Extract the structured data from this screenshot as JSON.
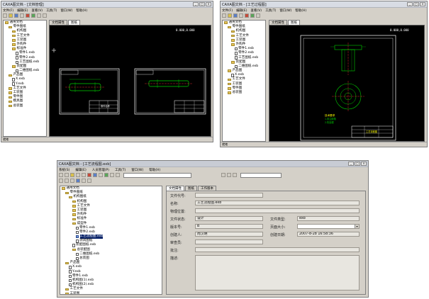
{
  "win_left": {
    "title": "CAXA图文档 - [文档管理]",
    "menu": [
      "文件(F)",
      "编辑(E)",
      "查看(V)",
      "工具(T)",
      "窗口(W)",
      "帮助(H)"
    ],
    "tabs": [
      "文档属性",
      "图纸"
    ],
    "tree": [
      {
        "text": "通用文档",
        "icon": "folder",
        "indent": 0
      },
      {
        "text": "零件图纸",
        "icon": "folder",
        "indent": 1
      },
      {
        "text": "机构图",
        "icon": "folder",
        "indent": 2
      },
      {
        "text": "工艺文件",
        "icon": "folder",
        "indent": 2
      },
      {
        "text": "工装图",
        "icon": "folder",
        "indent": 2
      },
      {
        "text": "外购件",
        "icon": "folder",
        "indent": 2
      },
      {
        "text": "标准件",
        "icon": "folder",
        "indent": 2
      },
      {
        "text": "零件1.exb",
        "icon": "doc",
        "indent": 3
      },
      {
        "text": "零件2.exb",
        "icon": "doc",
        "indent": 3
      },
      {
        "text": "工艺图纸.exb",
        "icon": "doc",
        "indent": 3
      },
      {
        "text": "装配图",
        "icon": "folder",
        "indent": 2
      },
      {
        "text": "二维图纸.exb",
        "icon": "doc",
        "indent": 3
      },
      {
        "text": "产品图",
        "icon": "folder",
        "indent": 1
      },
      {
        "text": "X.exb",
        "icon": "doc",
        "indent": 2
      },
      {
        "text": "Y.exb",
        "icon": "doc",
        "indent": 2
      },
      {
        "text": "工艺文件",
        "icon": "folder",
        "indent": 1
      },
      {
        "text": "工装图",
        "icon": "folder",
        "indent": 1
      },
      {
        "text": "零件图",
        "icon": "folder",
        "indent": 1
      },
      {
        "text": "模具图",
        "icon": "folder",
        "indent": 1
      },
      {
        "text": "总装图",
        "icon": "folder",
        "indent": 1
      }
    ],
    "status": "就绪"
  },
  "win_right": {
    "title": "CAXA图文档 - [工艺过程图]",
    "menu": [
      "文件(F)",
      "编辑(E)",
      "查看(V)",
      "工具(T)",
      "窗口(W)",
      "帮助(H)"
    ],
    "tabs": [
      "文档属性",
      "图纸"
    ],
    "tree": [
      {
        "text": "通用文档",
        "icon": "folder",
        "indent": 0
      },
      {
        "text": "零件图纸",
        "icon": "folder",
        "indent": 1
      },
      {
        "text": "机构图",
        "icon": "folder",
        "indent": 2
      },
      {
        "text": "工艺文件",
        "icon": "folder",
        "indent": 2
      },
      {
        "text": "工装图",
        "icon": "folder",
        "indent": 2
      },
      {
        "text": "外购件",
        "icon": "folder",
        "indent": 2
      },
      {
        "text": "零件1.exb",
        "icon": "doc",
        "indent": 3
      },
      {
        "text": "零件2.exb",
        "icon": "doc",
        "indent": 3
      },
      {
        "text": "工艺图纸.exb",
        "icon": "doc",
        "indent": 3
      },
      {
        "text": "装配图",
        "icon": "folder",
        "indent": 2
      },
      {
        "text": "二维图纸.exb",
        "icon": "doc",
        "indent": 3
      },
      {
        "text": "产品图",
        "icon": "folder",
        "indent": 1
      },
      {
        "text": "X.exb",
        "icon": "doc",
        "indent": 2
      },
      {
        "text": "工艺文件",
        "icon": "folder",
        "indent": 1
      },
      {
        "text": "工装图",
        "icon": "folder",
        "indent": 1
      },
      {
        "text": "零件图",
        "icon": "folder",
        "indent": 1
      },
      {
        "text": "总装图",
        "icon": "folder",
        "indent": 1
      }
    ],
    "status": "就绪"
  },
  "win_bottom": {
    "title": "CAXA图文档 - [工艺流程图.exb]",
    "menu": [
      "系统(S)",
      "编辑(E)",
      "人员管理(P)",
      "工具(T)",
      "窗口(W)",
      "帮助(H)"
    ],
    "tabs": [
      "文档属性",
      "图纸",
      "工作版本"
    ],
    "tree": [
      {
        "text": "通用文档",
        "icon": "folder",
        "indent": 0
      },
      {
        "text": "零件图纸",
        "icon": "folder",
        "indent": 1
      },
      {
        "text": "机构图纸",
        "icon": "folder",
        "indent": 2
      },
      {
        "text": "机构图",
        "icon": "folder",
        "indent": 3
      },
      {
        "text": "工艺文件",
        "icon": "folder",
        "indent": 3
      },
      {
        "text": "工装图",
        "icon": "folder",
        "indent": 3
      },
      {
        "text": "外购件",
        "icon": "folder",
        "indent": 3
      },
      {
        "text": "标准件",
        "icon": "folder",
        "indent": 3
      },
      {
        "text": "成型件",
        "icon": "folder",
        "indent": 3
      },
      {
        "text": "零件1.exb",
        "icon": "doc",
        "indent": 4
      },
      {
        "text": "零件2.exb",
        "icon": "doc",
        "indent": 4
      },
      {
        "text": "工艺流程图.exb",
        "icon": "dwg",
        "indent": 4,
        "selected": true
      },
      {
        "text": "测试图纸",
        "icon": "doc",
        "indent": 4
      },
      {
        "text": "装配图纸.exb",
        "icon": "doc",
        "indent": 3
      },
      {
        "text": "总装配图",
        "icon": "folder",
        "indent": 3
      },
      {
        "text": "二维图纸.exb",
        "icon": "doc",
        "indent": 4
      },
      {
        "text": "总装图",
        "icon": "doc",
        "indent": 4
      },
      {
        "text": "产品图",
        "icon": "folder",
        "indent": 1
      },
      {
        "text": "X.exb",
        "icon": "doc",
        "indent": 2
      },
      {
        "text": "Y.exb",
        "icon": "doc",
        "indent": 2
      },
      {
        "text": "零件1.exb",
        "icon": "doc",
        "indent": 2
      },
      {
        "text": "机构图(1).exb",
        "icon": "doc",
        "indent": 2
      },
      {
        "text": "机构图(2).exb",
        "icon": "doc",
        "indent": 2
      },
      {
        "text": "工艺文件",
        "icon": "folder",
        "indent": 1
      },
      {
        "text": "工装图",
        "icon": "folder",
        "indent": 1
      },
      {
        "text": "零件图",
        "icon": "folder",
        "indent": 1
      },
      {
        "text": "大型总装图.exb",
        "icon": "doc",
        "indent": 2
      },
      {
        "text": "总装图",
        "icon": "folder",
        "indent": 1
      },
      {
        "text": "总装配图",
        "icon": "folder",
        "indent": 1
      }
    ],
    "form": {
      "doc_code_label": "文件代号:",
      "doc_code_value": "",
      "name_label": "名称:",
      "name_value": "工艺流程图.exb",
      "location_label": "物理位置:",
      "location_value": "",
      "doc_status_label": "文件状态:",
      "doc_status_value": "设计",
      "doc_type_label": "文件类型:",
      "doc_type_value": "exb",
      "version_label": "版本号:",
      "version_value": "B",
      "size_label": "页面大小:",
      "size_value": "",
      "creator_label": "创建人:",
      "creator_value": "周汉明",
      "created_label": "创建日期:",
      "created_value": "2007-8-28 16:58:36",
      "reviewer_label": "审查员:",
      "reviewer_value": "",
      "remark_label": "批注:",
      "remark_value": "",
      "desc_label": "描述:",
      "desc_value": ""
    }
  },
  "canvas_left": {
    "coord": "0.000,0.000",
    "title_block_label": "零件名称"
  },
  "canvas_right": {
    "coord": "0.000,0.000",
    "title_block_label": "工艺流程图",
    "tech_notes": [
      "技术要求",
      "1.未注倒角",
      "2.热处理"
    ]
  },
  "colors": {
    "canvas": "#000000",
    "cad_green": "#00d000",
    "cad_white": "#ffffff",
    "cad_red": "#ff3030",
    "cad_yellow": "#ffff00",
    "selection": "#0a246a"
  }
}
